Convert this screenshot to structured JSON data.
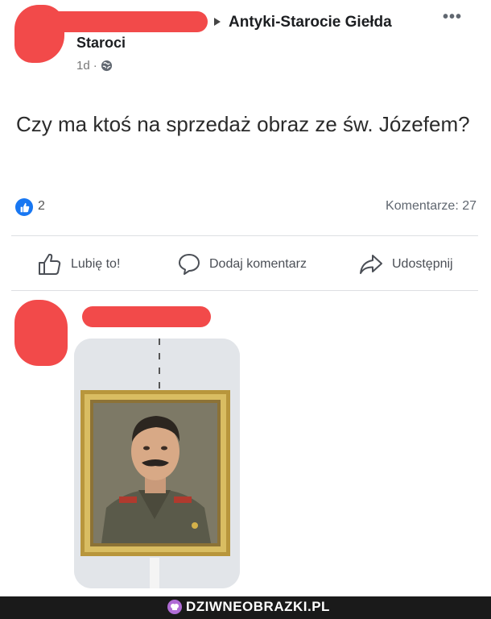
{
  "post": {
    "group_name": "Antyki-Starocie Giełda",
    "subgroup": "Staroci",
    "timestamp": "1d",
    "separator": "·",
    "more": "•••",
    "text": "Czy ma ktoś na sprzedaż obraz ze św. Józefem?",
    "like_count": "2",
    "comments_label": "Komentarze: 27"
  },
  "actions": {
    "like": "Lubię to!",
    "comment": "Dodaj komentarz",
    "share": "Udostępnij"
  },
  "watermark": {
    "text": "DZIWNEOBRAZKI.PL"
  },
  "colors": {
    "redaction": "#f24a4a",
    "like_blue": "#1877f2",
    "footer": "#1a1a1a"
  }
}
